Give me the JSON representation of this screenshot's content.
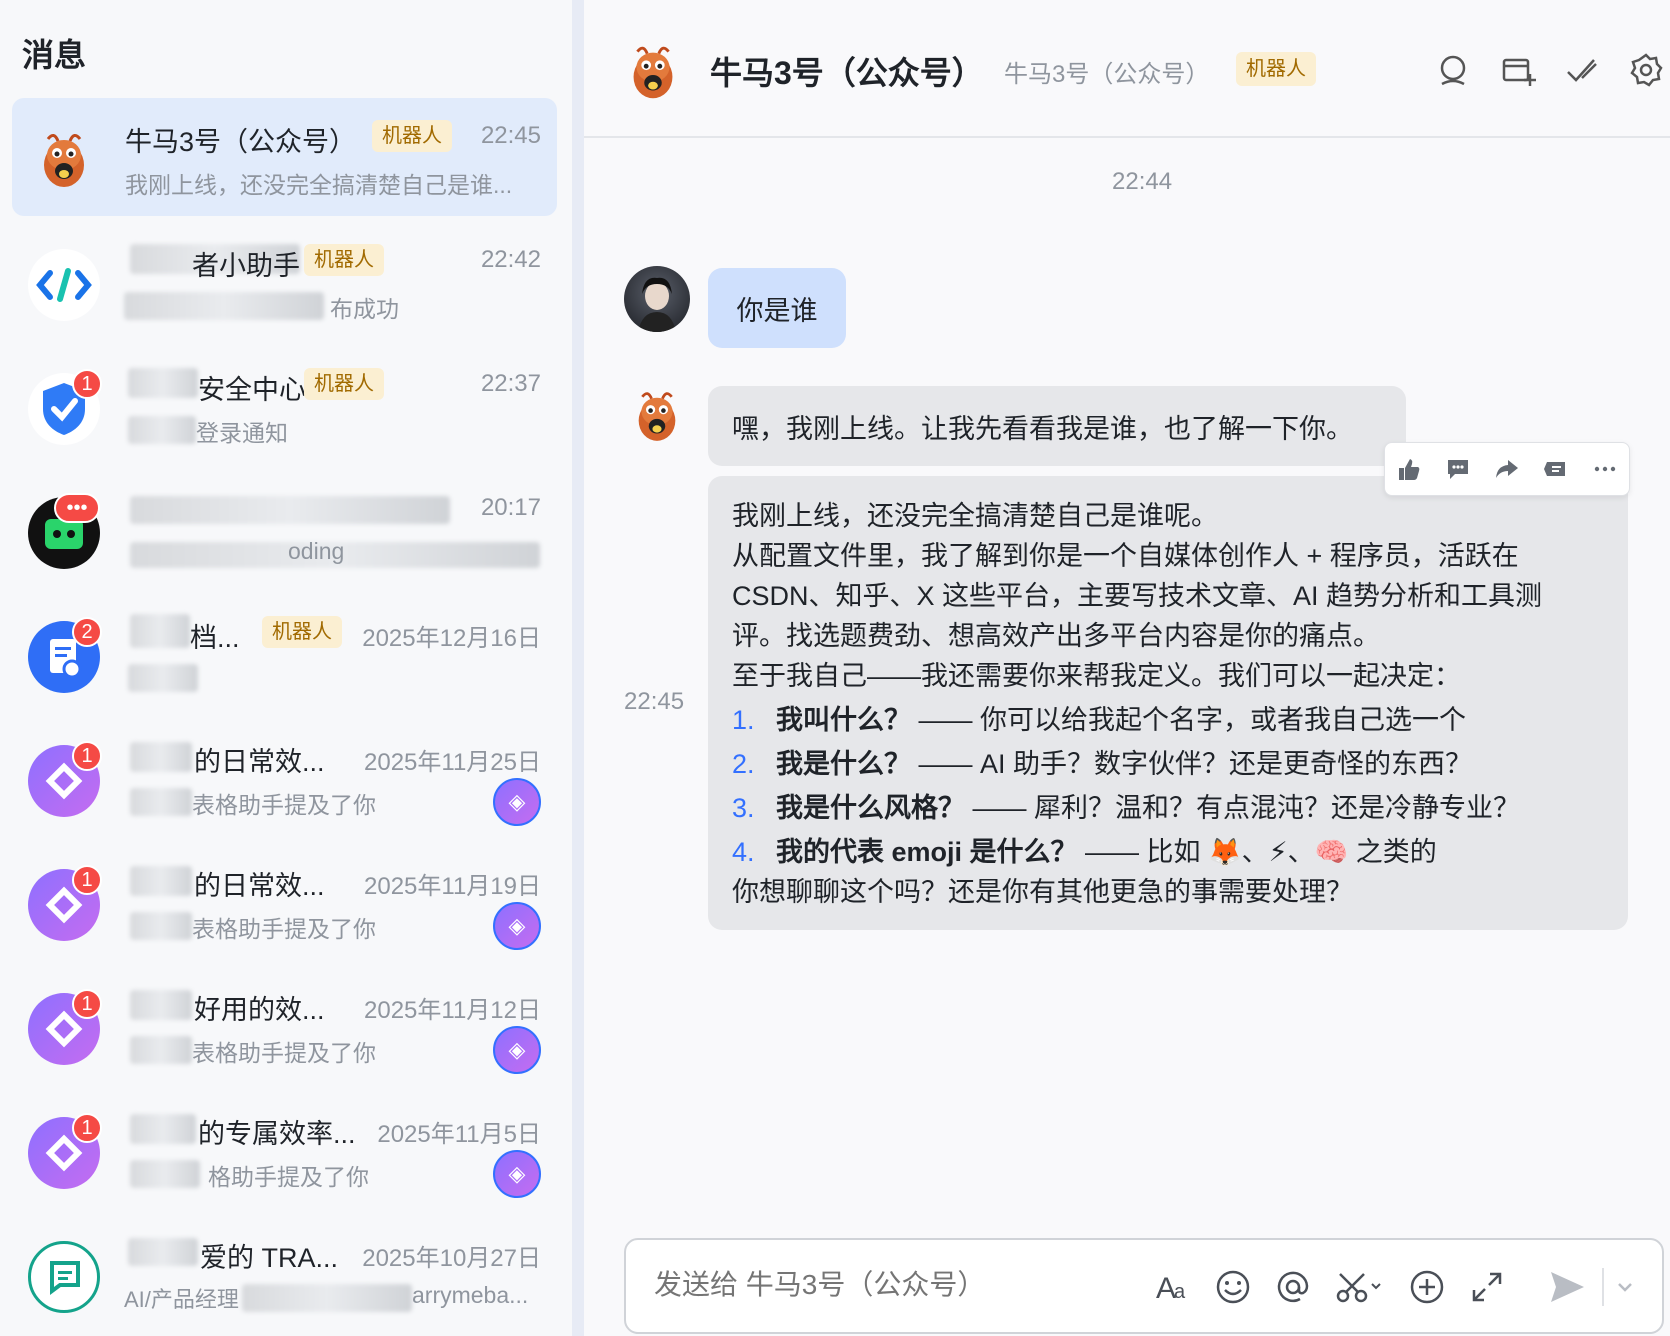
{
  "sidebar": {
    "title": "消息",
    "conversations": [
      {
        "name": "牛马3号（公众号）",
        "tag": "机器人",
        "time": "22:45",
        "preview": "我刚上线，还没完全搞清楚自己是谁..."
      },
      {
        "name": "者小助手",
        "tag": "机器人",
        "time": "22:42",
        "preview": "布成功"
      },
      {
        "name": "安全中心",
        "tag": "机器人",
        "time": "22:37",
        "preview": "登录通知",
        "badge": "1"
      },
      {
        "name": "",
        "tag": "",
        "time": "20:17",
        "preview": "oding",
        "badge": "•••"
      },
      {
        "name": "档...",
        "tag": "机器人",
        "time": "2025年12月16日",
        "preview": "",
        "badge": "2"
      },
      {
        "name": "的日常效...",
        "tag": "",
        "time": "2025年11月25日",
        "preview": "表格助手提及了你",
        "badge": "1"
      },
      {
        "name": "的日常效...",
        "tag": "",
        "time": "2025年11月19日",
        "preview": "表格助手提及了你",
        "badge": "1"
      },
      {
        "name": "好用的效...",
        "tag": "",
        "time": "2025年11月12日",
        "preview": "表格助手提及了你",
        "badge": "1"
      },
      {
        "name": "的专属效率...",
        "tag": "",
        "time": "2025年11月5日",
        "preview": "格助手提及了你",
        "badge": "1"
      },
      {
        "name": "爱的 TRA...",
        "tag": "",
        "time": "2025年10月27日",
        "preview": "AI/产品经理",
        "preview2": "arrymeba..."
      }
    ]
  },
  "header": {
    "title": "牛马3号（公众号）",
    "subtitle": "牛马3号（公众号）",
    "tag": "机器人"
  },
  "chat": {
    "time_divider": "22:44",
    "side_time": "22:45",
    "user_message": "你是谁",
    "bot_message_1": "嘿，我刚上线。让我先看看我是谁，也了解一下你。",
    "bot_message_2": {
      "lines": [
        "我刚上线，还没完全搞清楚自己是谁呢。",
        "从配置文件里，我了解到你是一个自媒体创作人 + 程序员，活跃在",
        "CSDN、知乎、X 这些平台，主要写技术文章、AI 趋势分析和工具测",
        "评。找选题费劲、想高效产出多平台内容是你的痛点。",
        "至于我自己——我还需要你来帮我定义。我们可以一起决定："
      ],
      "list": [
        {
          "num": "1.",
          "bold": "我叫什么？",
          "rest": " —— 你可以给我起个名字，或者我自己选一个"
        },
        {
          "num": "2.",
          "bold": "我是什么？",
          "rest": " —— AI 助手？数字伙伴？还是更奇怪的东西？"
        },
        {
          "num": "3.",
          "bold": "我是什么风格？",
          "rest": " —— 犀利？温和？有点混沌？还是冷静专业？"
        },
        {
          "num": "4.",
          "bold": "我的代表 emoji 是什么？",
          "rest": " —— 比如 🦊、⚡、🧠 之类的"
        }
      ],
      "closing": "你想聊聊这个吗？还是你有其他更急的事需要处理？"
    }
  },
  "input": {
    "placeholder": "发送给 牛马3号（公众号）"
  },
  "colors": {
    "accent": "#3370ff",
    "tag_bg": "#fbefd2",
    "tag_text": "#a16a00",
    "badge": "#f54a45"
  }
}
